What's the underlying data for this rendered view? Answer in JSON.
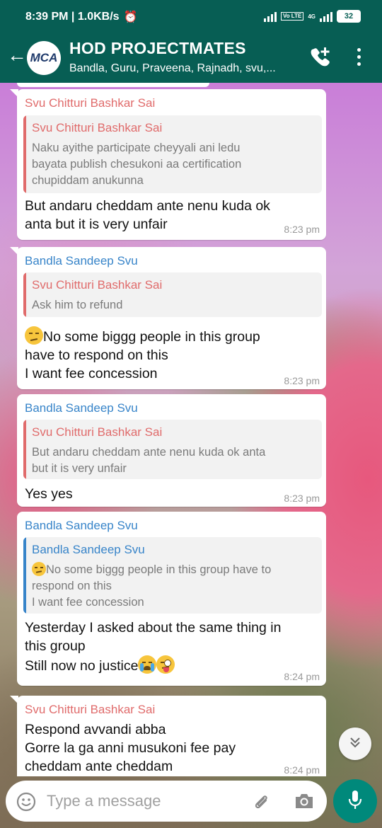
{
  "status_bar": {
    "time": "8:39 PM",
    "speed": "1.0KB/s",
    "network_label": "4G",
    "volte_label": "Vo LTE",
    "battery": "32"
  },
  "header": {
    "avatar_text": "MCA",
    "title": "HOD PROJECTMATES",
    "subtitle": "Bandla, Guru, Praveena, Rajnadh, svu,..."
  },
  "messages": [
    {
      "sender": "Svu Chitturi Bashkar Sai",
      "quote_name": "Svu Chitturi Bashkar Sai",
      "quote_lines": [
        "Naku ayithe participate cheyyali ani ledu",
        "bayata publish chesukoni aa certification",
        "chupiddam anukunna"
      ],
      "body_lines": [
        "But andaru cheddam ante nenu kuda ok",
        "anta but it is very unfair"
      ],
      "time": "8:23 pm"
    },
    {
      "sender": "Bandla Sandeep Svu",
      "quote_name": "Svu Chitturi Bashkar Sai",
      "quote_lines": [
        "Ask him to refund"
      ],
      "body_lines": [
        "No some biggg people in this group",
        "have to respond on this",
        "I want fee concession"
      ],
      "time": "8:23 pm"
    },
    {
      "sender": "Bandla Sandeep Svu",
      "quote_name": "Svu Chitturi Bashkar Sai",
      "quote_lines": [
        "But andaru cheddam ante nenu kuda ok anta",
        "but it is very unfair"
      ],
      "body_lines": [
        "Yes yes"
      ],
      "time": "8:23 pm"
    },
    {
      "sender": "Bandla Sandeep Svu",
      "quote_name": "Bandla Sandeep Svu",
      "quote_lines": [
        "No some biggg people in this group have to",
        "respond on this",
        "I want fee concession"
      ],
      "body_lines": [
        "Yesterday I asked about the same thing in",
        "this group",
        "Still now no justice"
      ],
      "time": "8:24 pm"
    },
    {
      "sender": "Svu Chitturi Bashkar Sai",
      "body_lines": [
        "Respond avvandi abba",
        "Gorre la ga anni musukoni fee pay",
        "cheddam ante cheddam"
      ],
      "time": "8:24 pm"
    }
  ],
  "composer": {
    "placeholder": "Type a message"
  },
  "icons": {
    "back": "arrow-left-icon",
    "call": "add-call-icon",
    "menu": "more-vert-icon",
    "emoji": "emoji-icon",
    "attach": "paperclip-icon",
    "camera": "camera-icon",
    "mic": "mic-icon",
    "scroll": "double-chevron-down-icon"
  },
  "colors": {
    "header": "#075e54",
    "mic_button": "#00897b",
    "sender_red": "#e06b6b",
    "sender_blue": "#3784c9"
  }
}
